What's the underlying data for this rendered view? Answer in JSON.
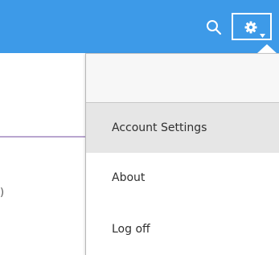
{
  "toolbar": {
    "search_icon": "search-icon",
    "settings_icon": "gear-icon",
    "dropdown_icon": "chevron-down-icon",
    "bar_color": "#3d9ae8"
  },
  "page": {
    "visible_fragment": ")"
  },
  "menu": {
    "items": [
      {
        "label": "Account Settings",
        "highlighted": true
      },
      {
        "label": "About",
        "highlighted": false
      },
      {
        "label": "Log off",
        "highlighted": false
      }
    ],
    "highlight_color": "#e6e6e6"
  }
}
